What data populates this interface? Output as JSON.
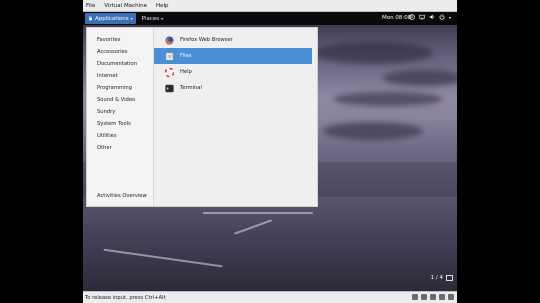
{
  "host_menu": {
    "items": [
      "File",
      "Virtual Machine",
      "Help"
    ]
  },
  "guest_panel": {
    "applications_label": "Applications",
    "places_label": "Places",
    "clock": "Mon 08:08",
    "tray_icons": [
      "accessibility-icon",
      "network-icon",
      "volume-icon",
      "power-icon"
    ]
  },
  "app_menu": {
    "categories": [
      "Favorites",
      "Accessories",
      "Documentation",
      "Internet",
      "Programming",
      "Sound & Video",
      "Sundry",
      "System Tools",
      "Utilities",
      "Other"
    ],
    "activities_overview": "Activities Overview",
    "apps": [
      {
        "label": "Firefox Web Browser",
        "icon": "firefox-icon",
        "selected": false
      },
      {
        "label": "Files",
        "icon": "files-icon",
        "selected": true
      },
      {
        "label": "Help",
        "icon": "help-icon",
        "selected": false
      },
      {
        "label": "Terminal",
        "icon": "terminal-icon",
        "selected": false
      }
    ]
  },
  "workspace": {
    "indicator": "1 / 4"
  },
  "host_status": {
    "message": "To release input, press Ctrl+Alt"
  }
}
